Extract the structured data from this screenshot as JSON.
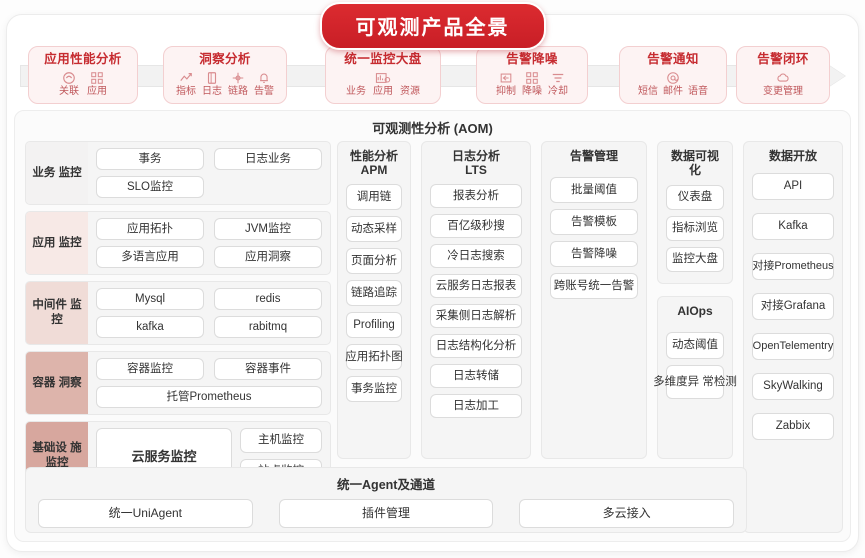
{
  "title": "可观测产品全景",
  "flow": {
    "stages": [
      {
        "name": "应用性能分析",
        "items": [
          {
            "label": "关联",
            "icon": "link-circle-icon"
          },
          {
            "label": "应用",
            "icon": "grid-apps-icon"
          }
        ]
      },
      {
        "name": "洞察分析",
        "items": [
          {
            "label": "指标",
            "icon": "trend-up-icon"
          },
          {
            "label": "日志",
            "icon": "document-icon"
          },
          {
            "label": "链路",
            "icon": "node-link-icon"
          },
          {
            "label": "告警",
            "icon": "bell-icon"
          }
        ]
      },
      {
        "name": "统一监控大盘",
        "items": [
          {
            "label": "业务",
            "icon": "dashboard-icon"
          },
          {
            "label": "应用",
            "icon": "dashboard-icon"
          },
          {
            "label": "资源",
            "icon": "dashboard-icon"
          }
        ]
      },
      {
        "name": "告警降噪",
        "items": [
          {
            "label": "抑制",
            "icon": "suppress-icon"
          },
          {
            "label": "降噪",
            "icon": "grid-apps-icon"
          },
          {
            "label": "冷却",
            "icon": "cooldown-icon"
          }
        ]
      },
      {
        "name": "告警通知",
        "items": [
          {
            "label": "短信",
            "icon": "at-icon"
          },
          {
            "label": "邮件",
            "icon": "at-icon"
          },
          {
            "label": "语音",
            "icon": "at-icon"
          }
        ]
      },
      {
        "name": "告警闭环",
        "items": [
          {
            "label": "变更管理",
            "icon": "cloud-icon"
          }
        ]
      }
    ]
  },
  "aom": {
    "title": "可观测性分析 (AOM)",
    "monitoring_rows": [
      {
        "label": "业务\n监控",
        "color": "#f3f2f2",
        "chips": [
          "事务",
          "日志业务",
          "SLO监控"
        ]
      },
      {
        "label": "应用\n监控",
        "color": "#f7e9e6",
        "chips": [
          "应用拓扑",
          "JVM监控",
          "多语言应用",
          "应用洞察"
        ]
      },
      {
        "label": "中间件\n监控",
        "color": "#f0dcd7",
        "chips": [
          "Mysql",
          "redis",
          "kafka",
          "rabitmq"
        ]
      },
      {
        "label": "容器\n洞察",
        "color": "#ddb4ab",
        "chips": [
          "容器监控",
          "容器事件",
          "托管Prometheus"
        ]
      }
    ],
    "infra_row": {
      "label": "基础设\n施监控",
      "color": "#d7a79e",
      "main": "云服务监控",
      "side": [
        "主机监控",
        "站点监控"
      ]
    },
    "columns": [
      {
        "title": "性能分析\nAPM",
        "chips": [
          "调用链",
          "动态采样",
          "页面分析",
          "链路追踪",
          "Profiling",
          "应用拓扑图",
          "事务监控"
        ]
      },
      {
        "title": "日志分析\nLTS",
        "chips": [
          "报表分析",
          "百亿级秒搜",
          "冷日志搜索",
          "云服务日志报表",
          "采集侧日志解析",
          "日志结构化分析",
          "日志转储",
          "日志加工"
        ]
      },
      {
        "title": "告警管理",
        "chips": [
          "批量阈值",
          "告警模板",
          "告警降噪",
          "跨账号统一告警"
        ]
      },
      {
        "title": "数据可视化",
        "chips": [
          "仪表盘",
          "指标浏览",
          "监控大盘"
        ]
      },
      {
        "title": "AIOps",
        "chips": [
          "动态阈值",
          "多维度异\n常检测"
        ]
      },
      {
        "title": "数据开放",
        "chips": [
          "API",
          "Kafka",
          "对接Prometheus",
          "对接Grafana",
          "OpenTelementry",
          "SkyWalking",
          "Zabbix"
        ]
      }
    ],
    "agent": {
      "title": "统一Agent及通道",
      "chips": [
        "统一UniAgent",
        "插件管理",
        "多云接入"
      ]
    }
  }
}
